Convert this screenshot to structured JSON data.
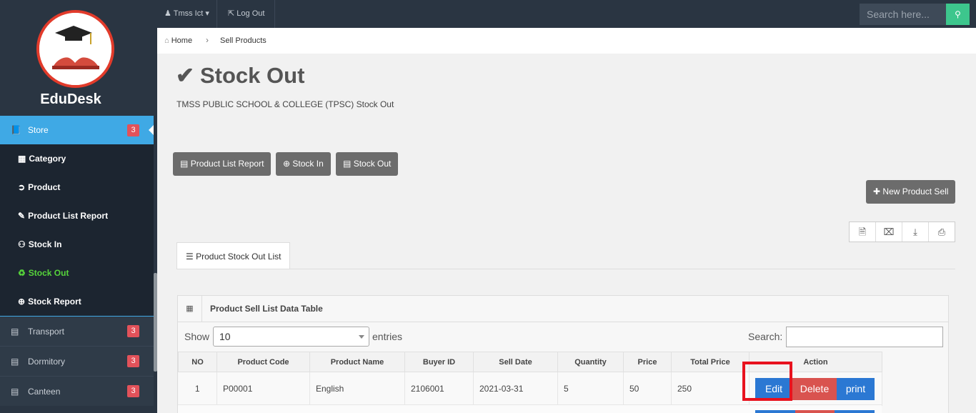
{
  "app": {
    "name": "EduDesk"
  },
  "topbar": {
    "user": "Tmss Ict",
    "logout": "Log Out",
    "search_placeholder": "Search here..."
  },
  "breadcrumb": {
    "home": "Home",
    "current": "Sell Products"
  },
  "sidebar": {
    "store": {
      "label": "Store",
      "badge": "3"
    },
    "store_items": [
      {
        "label": "Category",
        "icon": "grid-icon"
      },
      {
        "label": "Product",
        "icon": "product-icon"
      },
      {
        "label": "Product List Report",
        "icon": "report-icon"
      },
      {
        "label": "Stock In",
        "icon": "user-plus-icon"
      },
      {
        "label": "Stock Out",
        "icon": "recycle-icon"
      },
      {
        "label": "Stock Report",
        "icon": "plus-circle-icon"
      }
    ],
    "groups": [
      {
        "label": "Transport",
        "badge": "3"
      },
      {
        "label": "Dormitory",
        "badge": "3"
      },
      {
        "label": "Canteen",
        "badge": "3"
      }
    ]
  },
  "page": {
    "title": "Stock Out",
    "subtitle": "TMSS PUBLIC SCHOOL & COLLEGE (TPSC) Stock Out",
    "buttons": {
      "product_list_report": "Product List Report",
      "stock_in": "Stock In",
      "stock_out": "Stock Out",
      "new_sell": "New Product Sell"
    },
    "tab": "Product Stock Out List"
  },
  "table": {
    "panel_title": "Product Sell List Data Table",
    "show_label": "Show",
    "page_size": "10",
    "entries_label": "entries",
    "search_label": "Search:",
    "columns": [
      "NO",
      "Product Code",
      "Product Name",
      "Buyer ID",
      "Sell Date",
      "Quantity",
      "Price",
      "Total Price",
      "Action"
    ],
    "rows": [
      {
        "no": "1",
        "code": "P00001",
        "name": "English",
        "buyer": "2106001",
        "date": "2021-03-31",
        "qty": "5",
        "price": "50",
        "total": "250"
      }
    ],
    "actions": {
      "edit": "Edit",
      "delete": "Delete",
      "print": "print"
    }
  },
  "colors": {
    "sidebar": "#2a3542",
    "active": "#3fa9e5",
    "badge": "#e2525a",
    "current": "#56d43b",
    "highlight": "#e8121e"
  }
}
